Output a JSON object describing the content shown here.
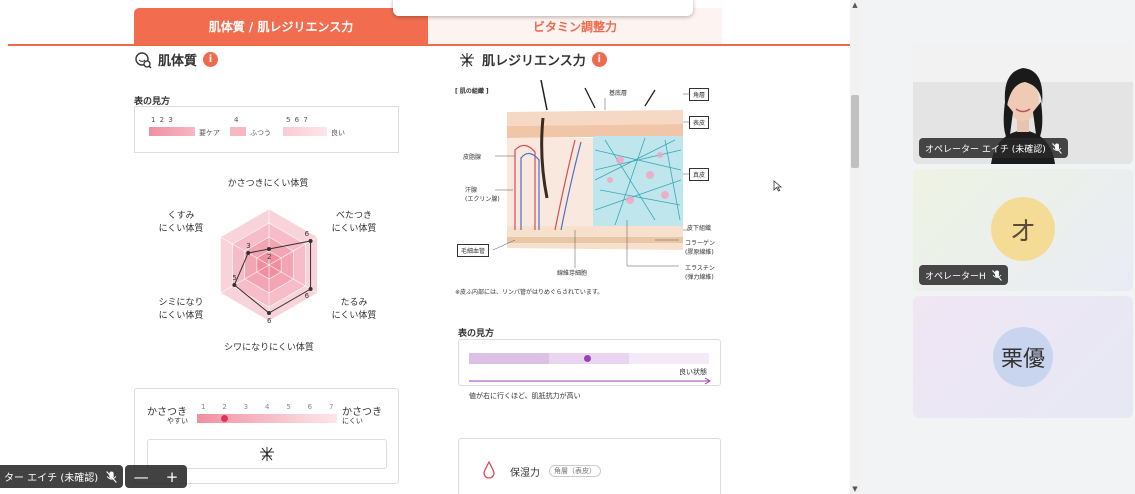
{
  "tabs": {
    "active": "肌体質 / 肌レジリエンス力",
    "inactive": "ビタミン調整力"
  },
  "left": {
    "title": "肌体質",
    "legend_title": "表の見方",
    "legend": {
      "group1_nums": "1 2 3",
      "group1_label": "要ケア",
      "group2_nums": "4",
      "group2_label": "ふつう",
      "group3_nums": "5 6 7",
      "group3_label": "良い"
    },
    "radar": {
      "label_top": "かさつきにくい体質",
      "label_upper_right": "べたつき\nにくい体質",
      "label_lower_right": "たるみ\nにくい体質",
      "label_bottom": "シワになりにくい体質",
      "label_lower_left": "シミになり\nにくい体質",
      "label_upper_left": "くすみ\nにくい体質",
      "values": [
        2,
        6,
        6,
        6,
        5,
        3
      ],
      "value_labels": [
        "2",
        "6",
        "6",
        "6",
        "5",
        "3"
      ]
    },
    "scale_card": {
      "left_main": "かさつき",
      "left_sub": "やすい",
      "right_main": "かさつき",
      "right_sub": "にくい",
      "numbers": [
        "1",
        "2",
        "3",
        "4",
        "5",
        "6",
        "7"
      ],
      "value": 2
    }
  },
  "right": {
    "title": "肌レジリエンス力",
    "diagram": {
      "heading": "[ 肌の組織 ]",
      "labels": {
        "kitei": "基底層",
        "kakusou": "角層",
        "hyouhi": "表皮",
        "shinpi": "真皮",
        "hika": "皮下組織",
        "sebaceous": "皮脂腺",
        "sweat": "汗腺",
        "sweat_sub": "(エクリン腺)",
        "capillary": "毛細血管",
        "fibroblast": "線維芽細胞",
        "collagen": "コラーゲン",
        "collagen_sub": "(膠原線維)",
        "elastin": "エラスチン",
        "elastin_sub": "(弾力線維)"
      },
      "note": "※皮ふ内部には、リンパ管がはりめぐらされています。"
    },
    "legend_title": "表の見方",
    "legend": {
      "good_state": "良い状態",
      "description": "値が右に行くほど、肌抵抗力が高い",
      "value_fraction": 0.49
    },
    "card": {
      "label": "保湿力",
      "tag": "角層（表皮）"
    }
  },
  "participants": [
    {
      "name": "オペレーター エイチ (未確認)",
      "type": "video"
    },
    {
      "name": "オペレーターH",
      "initial": "オ",
      "type": "avatar",
      "color": "#f5dc96"
    },
    {
      "name": "",
      "initial": "栗優",
      "type": "avatar",
      "color": "#c9d4ee"
    }
  ],
  "self_view": {
    "name": "ター エイチ (未確認)",
    "zoom_minus": "—",
    "zoom_plus": "+"
  },
  "colors": {
    "accent": "#f26d50",
    "pink": "#f6a7b5",
    "purple": "#9b3fb7"
  }
}
